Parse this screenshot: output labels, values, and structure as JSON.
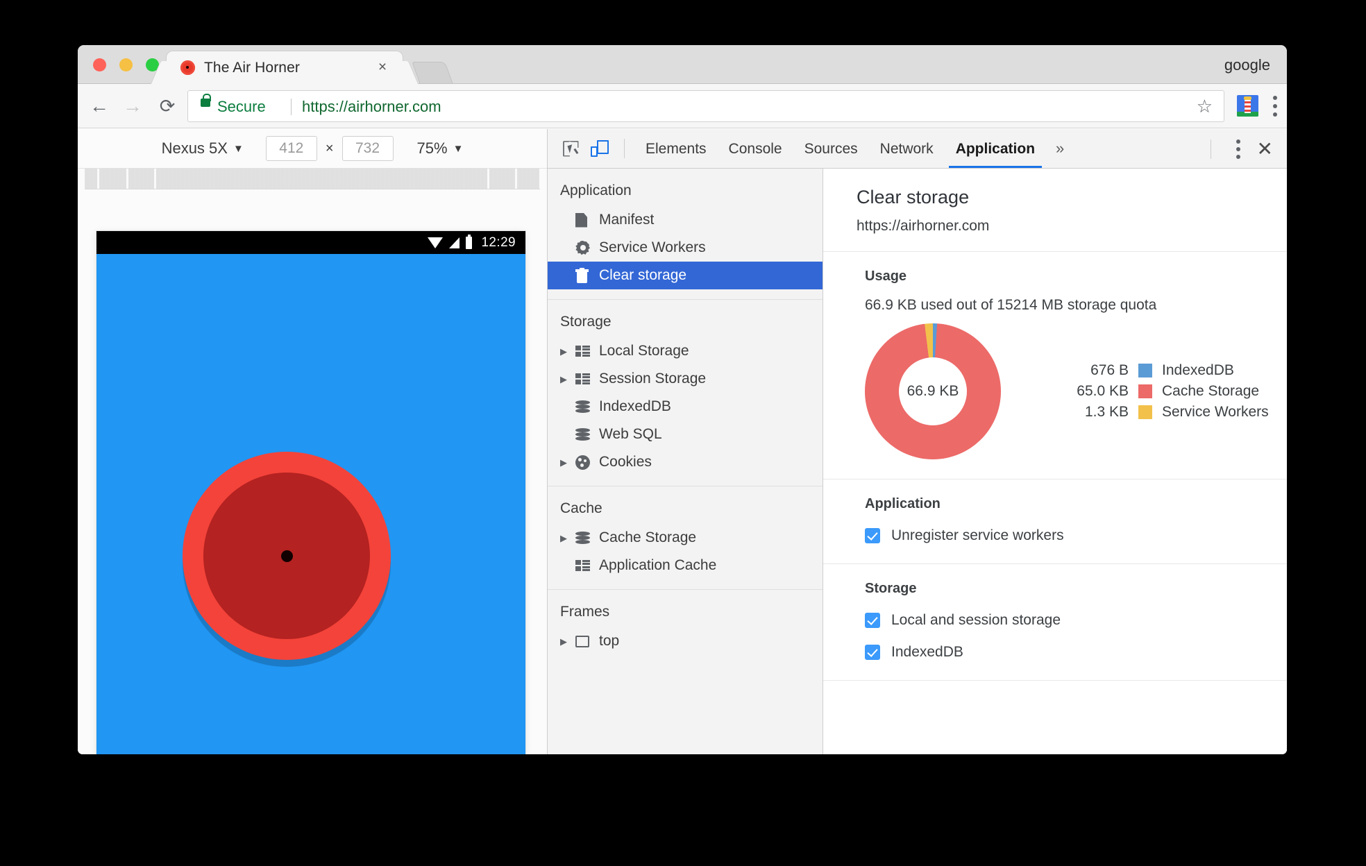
{
  "browser": {
    "profile_name": "google",
    "tab": {
      "title": "The Air Horner",
      "close_label": "×",
      "favicon": "air-horn-favicon"
    },
    "nav": {
      "back": "←",
      "forward": "→",
      "reload": "⟳"
    },
    "omnibox": {
      "security_label": "Secure",
      "url": "https://airhorner.com",
      "star": "☆"
    },
    "extension": "lighthouse-extension-icon"
  },
  "emulation": {
    "device": "Nexus 5X",
    "width": "412",
    "height": "732",
    "zoom": "75%",
    "caret": "▼",
    "dimension_separator": "×",
    "page": {
      "status_bar": {
        "time": "12:29",
        "wifi": "wifi-icon",
        "signal": "signal-icon",
        "battery": "battery-icon"
      },
      "horn_button": "air-horn-button",
      "background_color": "#2196f3",
      "horn_outer_color": "#f4433a",
      "horn_inner_color": "#b42221"
    }
  },
  "devtools": {
    "tabs": [
      {
        "label": "Elements",
        "active": false
      },
      {
        "label": "Console",
        "active": false
      },
      {
        "label": "Sources",
        "active": false
      },
      {
        "label": "Network",
        "active": false
      },
      {
        "label": "Application",
        "active": true
      }
    ],
    "more_tabs": "»",
    "close": "✕",
    "accent_color": "#1a73e8",
    "sidebar": {
      "groups": [
        {
          "title": "Application",
          "items": [
            {
              "label": "Manifest",
              "icon": "document-icon",
              "arrow": false,
              "selected": false
            },
            {
              "label": "Service Workers",
              "icon": "gear-icon",
              "arrow": false,
              "selected": false
            },
            {
              "label": "Clear storage",
              "icon": "trash-icon",
              "arrow": false,
              "selected": true
            }
          ]
        },
        {
          "title": "Storage",
          "items": [
            {
              "label": "Local Storage",
              "icon": "table-icon",
              "arrow": true,
              "selected": false
            },
            {
              "label": "Session Storage",
              "icon": "table-icon",
              "arrow": true,
              "selected": false
            },
            {
              "label": "IndexedDB",
              "icon": "database-icon",
              "arrow": false,
              "selected": false
            },
            {
              "label": "Web SQL",
              "icon": "database-icon",
              "arrow": false,
              "selected": false
            },
            {
              "label": "Cookies",
              "icon": "cookie-icon",
              "arrow": true,
              "selected": false
            }
          ]
        },
        {
          "title": "Cache",
          "items": [
            {
              "label": "Cache Storage",
              "icon": "database-icon",
              "arrow": true,
              "selected": false
            },
            {
              "label": "Application Cache",
              "icon": "table-icon",
              "arrow": false,
              "selected": false
            }
          ]
        },
        {
          "title": "Frames",
          "items": [
            {
              "label": "top",
              "icon": "frame-icon",
              "arrow": true,
              "selected": false
            }
          ]
        }
      ]
    },
    "panel": {
      "title": "Clear storage",
      "origin": "https://airhorner.com",
      "usage": {
        "section_title": "Usage",
        "summary": "66.9 KB used out of 15214 MB storage quota",
        "center_label": "66.9 KB"
      },
      "application": {
        "section_title": "Application",
        "checkboxes": [
          {
            "label": "Unregister service workers",
            "checked": true
          }
        ]
      },
      "storage": {
        "section_title": "Storage",
        "checkboxes": [
          {
            "label": "Local and session storage",
            "checked": true
          },
          {
            "label": "IndexedDB",
            "checked": true
          }
        ]
      }
    }
  },
  "chart_data": {
    "type": "pie",
    "title": "Usage",
    "subtitle": "66.9 KB used out of 15214 MB storage quota",
    "center_label": "66.9 KB",
    "total_bytes": 66900,
    "legend_position": "right",
    "categories": [
      "IndexedDB",
      "Cache Storage",
      "Service Workers"
    ],
    "values": [
      676,
      66560,
      1331
    ],
    "value_labels": [
      "676 B",
      "65.0 KB",
      "1.3 KB"
    ],
    "colors": [
      "#5b9bd5",
      "#ec6a68",
      "#f2c14b"
    ],
    "slices": [
      {
        "name": "IndexedDB",
        "value_label": "676 B",
        "bytes": 676,
        "color": "#5b9bd5",
        "percent": 1.0
      },
      {
        "name": "Cache Storage",
        "value_label": "65.0 KB",
        "bytes": 66560,
        "color": "#ec6a68",
        "percent": 97.0
      },
      {
        "name": "Service Workers",
        "value_label": "1.3 KB",
        "bytes": 1331,
        "color": "#f2c14b",
        "percent": 2.0
      }
    ]
  }
}
